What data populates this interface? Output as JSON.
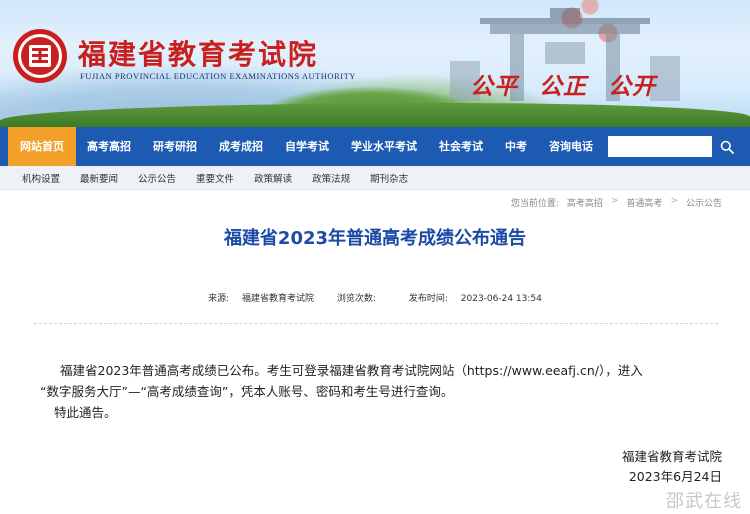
{
  "header": {
    "title": "福建省教育考试院",
    "subtitle": "FUJIAN PROVINCIAL EDUCATION EXAMINATIONS AUTHORITY",
    "motto": "公平 公正 公开"
  },
  "nav": {
    "items": [
      {
        "label": "网站首页",
        "active": true
      },
      {
        "label": "高考高招"
      },
      {
        "label": "研考研招"
      },
      {
        "label": "成考成招"
      },
      {
        "label": "自学考试"
      },
      {
        "label": "学业水平考试"
      },
      {
        "label": "社会考试"
      },
      {
        "label": "中考"
      },
      {
        "label": "咨询电话"
      }
    ],
    "search": {
      "value": "",
      "placeholder": ""
    }
  },
  "subnav": {
    "items": [
      "机构设置",
      "最新要闻",
      "公示公告",
      "重要文件",
      "政策解读",
      "政策法规",
      "期刊杂志"
    ]
  },
  "breadcrumb": {
    "prefix": "您当前位置:",
    "items": [
      "高考高招",
      "普通高考",
      "公示公告"
    ],
    "separator": ">"
  },
  "article": {
    "title": "福建省2023年普通高考成绩公布通告",
    "source_label": "来源:",
    "source": "福建省教育考试院",
    "views_label": "浏览次数:",
    "views": "",
    "published_label": "发布时间:",
    "published": "2023-06-24 13:54",
    "paragraph1": "福建省2023年普通高考成绩已公布。考生可登录福建省教育考试院网站（https://www.eeafj.cn/），进入",
    "paragraph2": "“数字服务大厅”—“高考成绩查询”，凭本人账号、密码和考生号进行查询。",
    "paragraph3": "特此通告。",
    "signature_org": "福建省教育考试院",
    "signature_date": "2023年6月24日"
  },
  "watermark": "邵武在线",
  "colors": {
    "nav_bg": "#1d5ab2",
    "nav_active": "#f3a02a",
    "title_blue": "#1c4aa6",
    "brand_red": "#c91f1f"
  }
}
